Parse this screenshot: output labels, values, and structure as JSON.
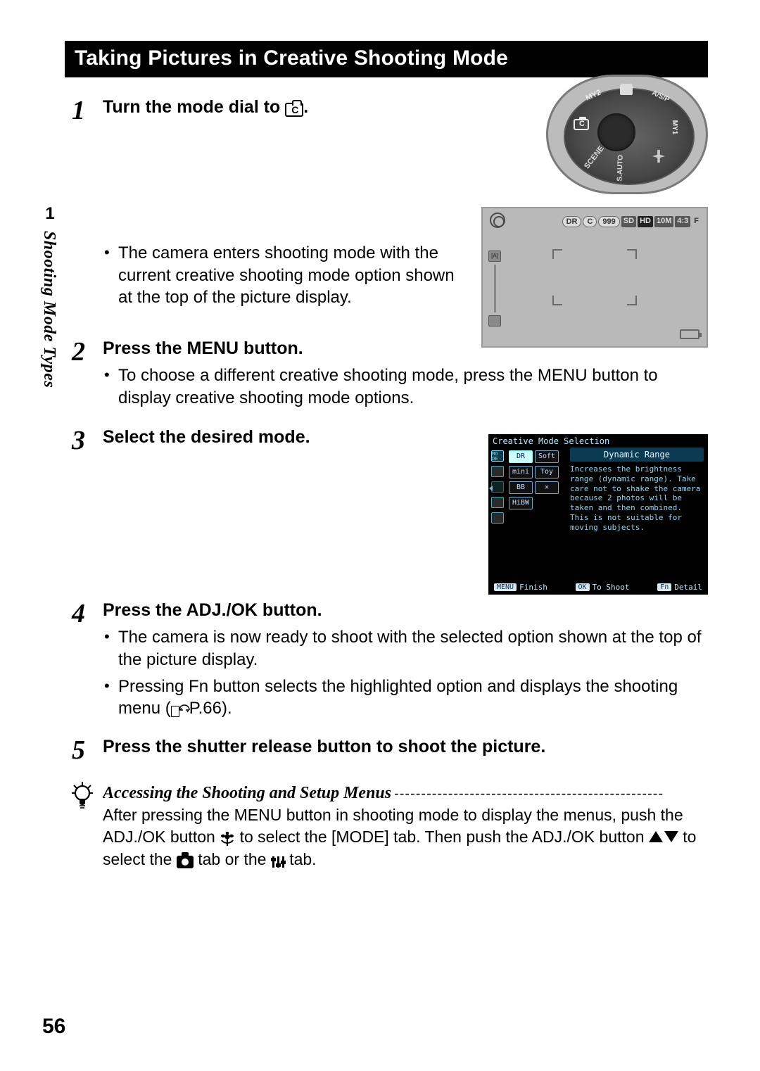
{
  "title_bar": "Taking Pictures in Creative Shooting Mode",
  "side": {
    "num": "1",
    "label": "Shooting Mode Types"
  },
  "steps": {
    "s1": {
      "num": "1",
      "heading_pre": "Turn the mode dial to ",
      "heading_post": ".",
      "bullet": "The camera enters shooting mode with the current creative shooting mode option shown at the top of the picture display."
    },
    "s2": {
      "num": "2",
      "heading": "Press the MENU button.",
      "bullet": "To choose a different creative shooting mode, press the MENU button to display creative shooting mode options."
    },
    "s3": {
      "num": "3",
      "heading": "Select the desired mode."
    },
    "s4": {
      "num": "4",
      "heading": "Press the ADJ./OK button.",
      "bullet1": "The camera is now ready to shoot with the selected option shown at the top of the picture display.",
      "bullet2_pre": "Pressing Fn button selects the highlighted option and displays the shooting menu (",
      "bullet2_ref": "P.66",
      "bullet2_post": ")."
    },
    "s5": {
      "num": "5",
      "heading": "Press the shutter release button to shoot the picture."
    }
  },
  "tip": {
    "heading": "Accessing the Shooting and Setup Menus",
    "text_pre": "After pressing the MENU button in shooting mode to display the menus, push the ADJ./OK button ",
    "text_mid1": " to select the [MODE] tab. Then push the ADJ./OK button ",
    "text_mid2": " to select the ",
    "text_or": " tab or the ",
    "text_post": " tab."
  },
  "dial": {
    "labels": {
      "scene": "SCENE",
      "sauto": "S.AUTO",
      "my1": "MY1",
      "snaps": "A/S/P",
      "my2": "MY2"
    }
  },
  "lcd": {
    "tags": {
      "dr": "DR",
      "c": "C",
      "count": "999",
      "sd": "SD",
      "hd": "HD",
      "size": "10M",
      "ratio": "4:3",
      "fine": "F"
    },
    "left": {
      "top": "[A]",
      "bot": ""
    }
  },
  "menu": {
    "header": "Creative Mode Selection",
    "side_label": "MO\nDE",
    "modes": {
      "dr": "DR",
      "soft": "Soft",
      "mini": "mini",
      "toy": "Toy",
      "bb": "BB",
      "xp": "✕",
      "bw": "HiBW"
    },
    "desc_title": "Dynamic Range",
    "desc_text": "Increases the brightness range (dynamic range). Take care not to shake the camera because 2 photos will be taken and then combined. This is not suitable for moving subjects.",
    "footer": {
      "menu_btn": "MENU",
      "finish": "Finish",
      "ok_btn": "OK",
      "to_shoot": "To Shoot",
      "fn_btn": "Fn",
      "detail": "Detail"
    }
  },
  "page_num": "56"
}
